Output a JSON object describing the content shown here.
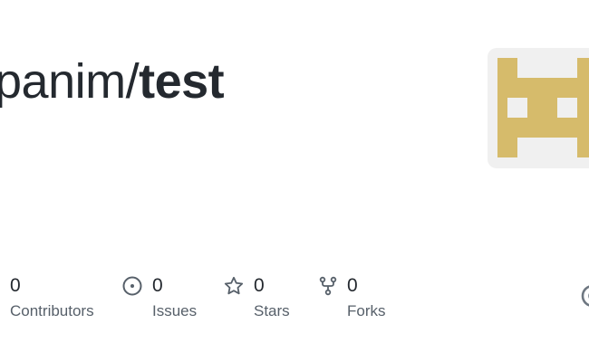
{
  "repo": {
    "owner": "panim",
    "separator": "/",
    "name": "test"
  },
  "avatar": {
    "background": "#f0f0f0",
    "pixel_color": "#d6bb6b",
    "icon": "identicon"
  },
  "stats": {
    "contributors": {
      "count": "0",
      "label": "Contributors",
      "icon": "people-icon"
    },
    "issues": {
      "count": "0",
      "label": "Issues",
      "icon": "issue-opened-icon"
    },
    "stars": {
      "count": "0",
      "label": "Stars",
      "icon": "star-icon"
    },
    "forks": {
      "count": "0",
      "label": "Forks",
      "icon": "repo-forked-icon"
    }
  },
  "colors": {
    "text_primary": "#24292f",
    "text_secondary": "#57606a",
    "icon": "#57606a"
  }
}
